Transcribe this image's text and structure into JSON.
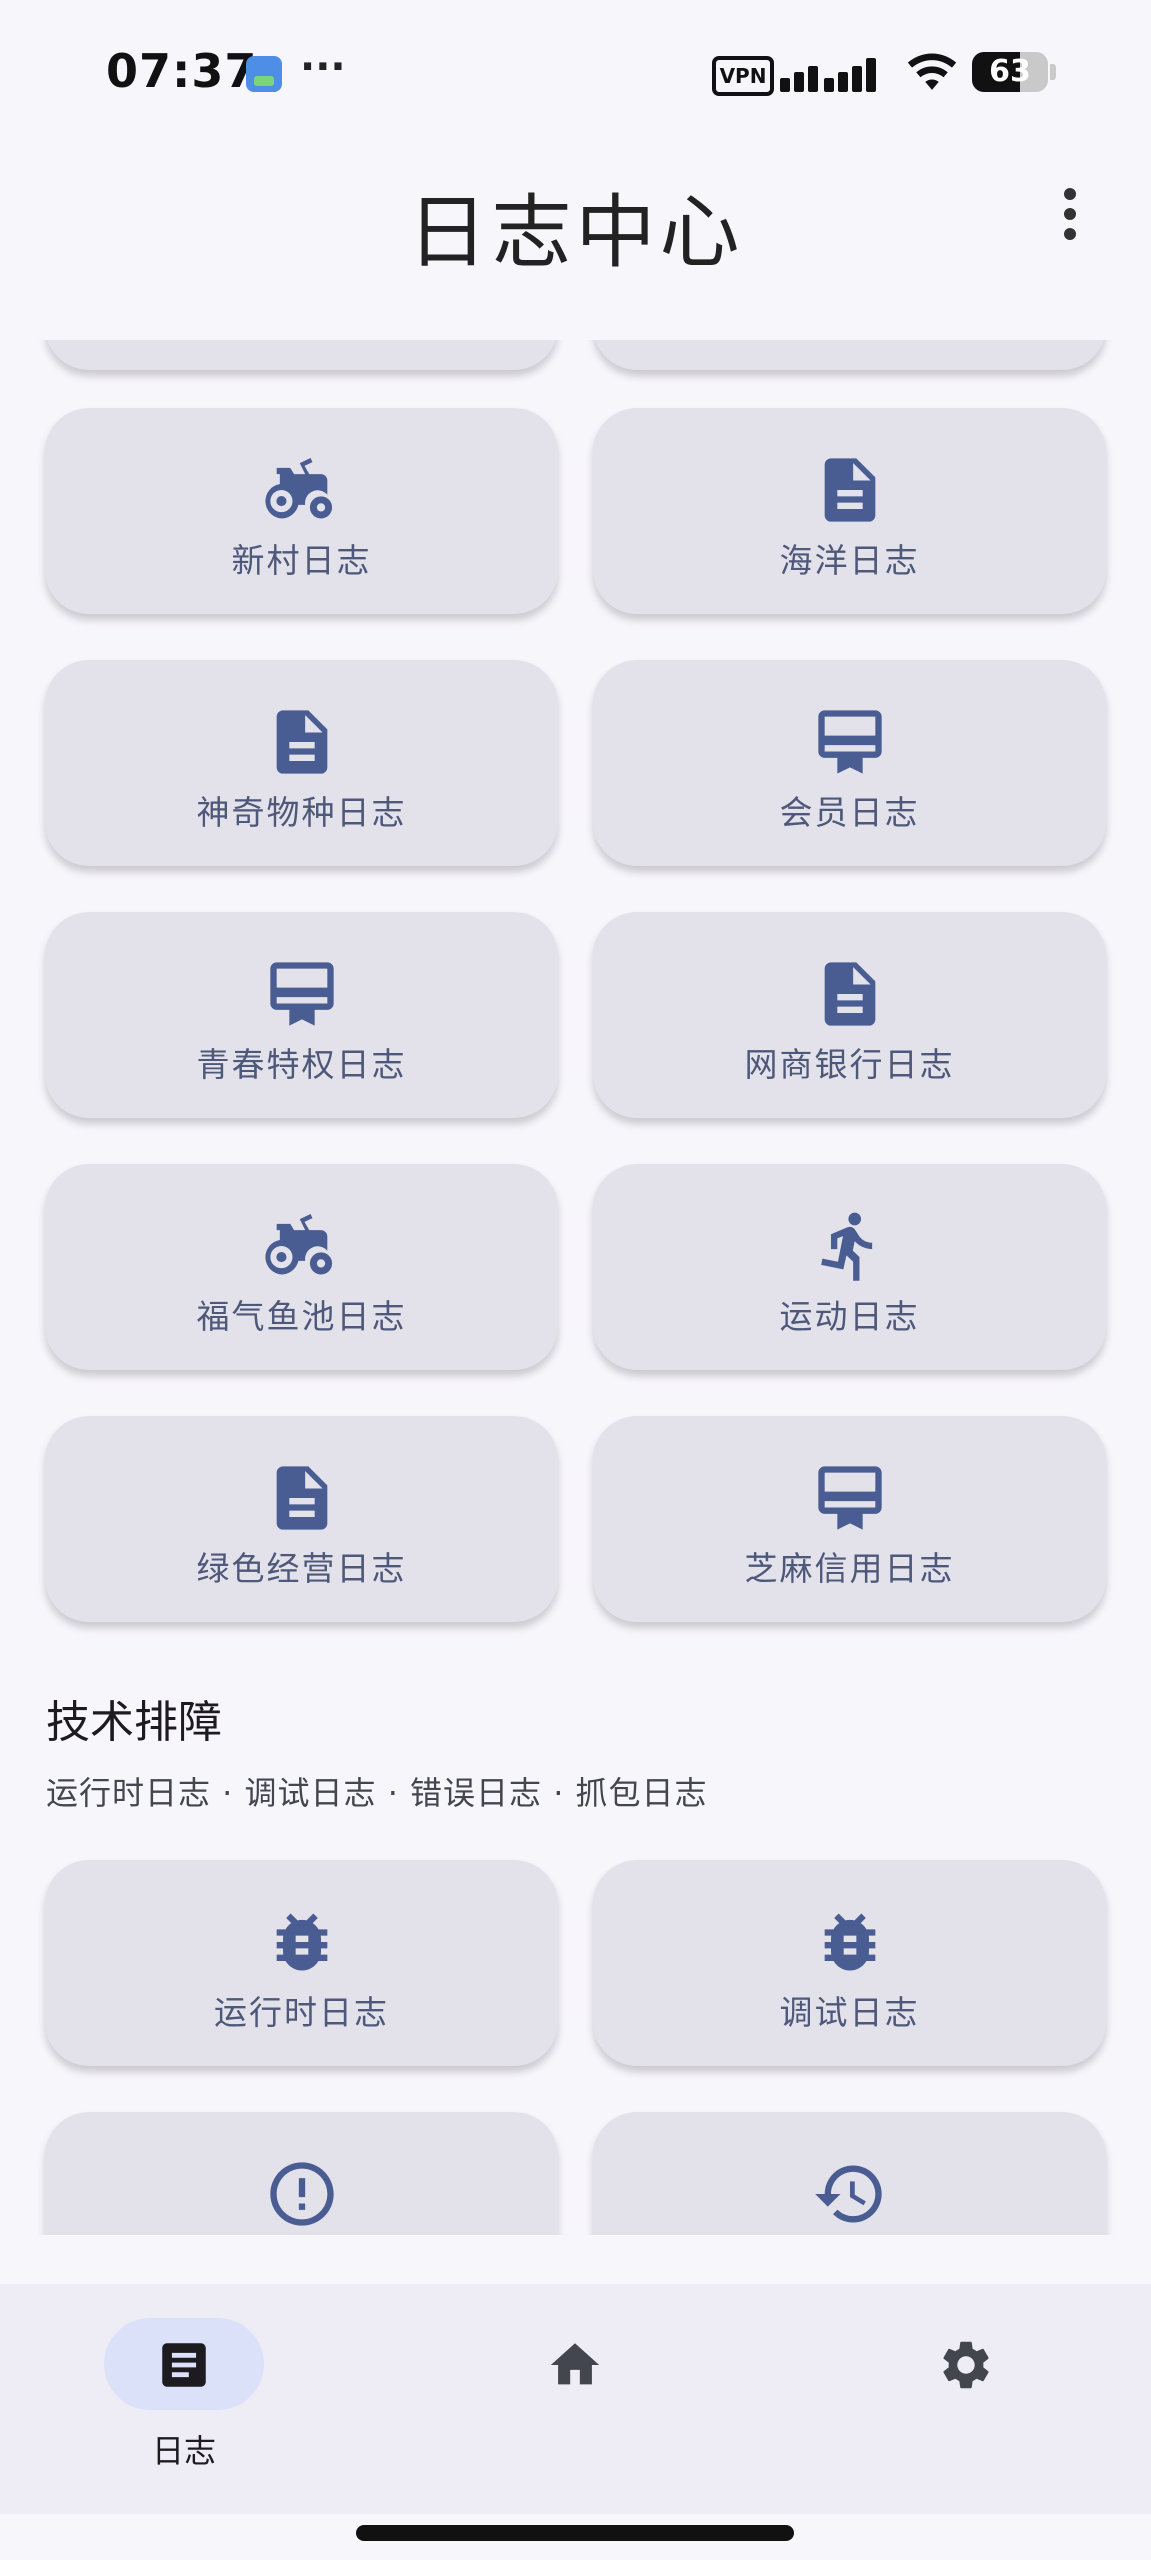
{
  "status_bar": {
    "time": "07:37",
    "more_indicator": "···",
    "vpn_label": "VPN",
    "battery_level": "63",
    "battery_percent": 63
  },
  "header": {
    "title": "日志中心",
    "menu_icon": "more-vert-icon"
  },
  "cards": [
    {
      "label": "新村日志",
      "icon": "tractor-icon"
    },
    {
      "label": "海洋日志",
      "icon": "document-icon"
    },
    {
      "label": "神奇物种日志",
      "icon": "document-icon"
    },
    {
      "label": "会员日志",
      "icon": "card-membership-icon"
    },
    {
      "label": "青春特权日志",
      "icon": "card-membership-icon"
    },
    {
      "label": "网商银行日志",
      "icon": "document-icon"
    },
    {
      "label": "福气鱼池日志",
      "icon": "tractor-icon"
    },
    {
      "label": "运动日志",
      "icon": "run-icon"
    },
    {
      "label": "绿色经营日志",
      "icon": "document-icon"
    },
    {
      "label": "芝麻信用日志",
      "icon": "card-membership-icon"
    }
  ],
  "tech_section": {
    "title": "技术排障",
    "subtitle": "运行时日志 · 调试日志 · 错误日志 · 抓包日志",
    "cards": [
      {
        "label": "运行时日志",
        "icon": "bug-icon"
      },
      {
        "label": "调试日志",
        "icon": "bug-icon"
      },
      {
        "label": "",
        "icon": "error-icon"
      },
      {
        "label": "",
        "icon": "history-icon"
      }
    ]
  },
  "bottom_nav": {
    "items": [
      {
        "label": "日志",
        "icon": "article-icon",
        "active": true
      },
      {
        "label": "",
        "icon": "home-icon",
        "active": false
      },
      {
        "label": "",
        "icon": "gear-icon",
        "active": false
      }
    ]
  },
  "colors": {
    "background": "#f7f6fb",
    "card": "#e3e2ea",
    "icon": "#4a5d93",
    "label": "#4d587a",
    "nav_active": "#dbe1f8"
  }
}
